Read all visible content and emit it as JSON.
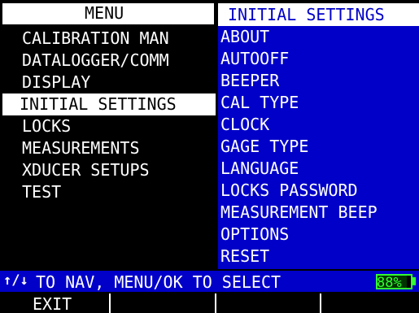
{
  "menu": {
    "title": "MENU",
    "items": [
      {
        "label": "CALIBRATION MAN",
        "selected": false
      },
      {
        "label": "DATALOGGER/COMM",
        "selected": false
      },
      {
        "label": "DISPLAY",
        "selected": false
      },
      {
        "label": "INITIAL SETTINGS",
        "selected": true
      },
      {
        "label": "LOCKS",
        "selected": false
      },
      {
        "label": "MEASUREMENTS",
        "selected": false
      },
      {
        "label": "XDUCER SETUPS",
        "selected": false
      },
      {
        "label": "TEST",
        "selected": false
      }
    ]
  },
  "submenu": {
    "title": "INITIAL SETTINGS",
    "items": [
      "ABOUT",
      "AUTOOFF",
      "BEEPER",
      "CAL TYPE",
      "CLOCK",
      "GAGE TYPE",
      "LANGUAGE",
      "LOCKS PASSWORD",
      "MEASUREMENT BEEP",
      "OPTIONS",
      "RESET"
    ]
  },
  "status": {
    "arrows": "↑/↓",
    "hint": "TO NAV, MENU/OK TO SELECT",
    "battery_text": "88%",
    "battery_level": 0.88
  },
  "softkeys": [
    "EXIT",
    "",
    "",
    ""
  ],
  "colors": {
    "background": "#000000",
    "panel_blue": "#0000c8",
    "highlight": "#ffffff",
    "battery_green": "#33ff33"
  }
}
